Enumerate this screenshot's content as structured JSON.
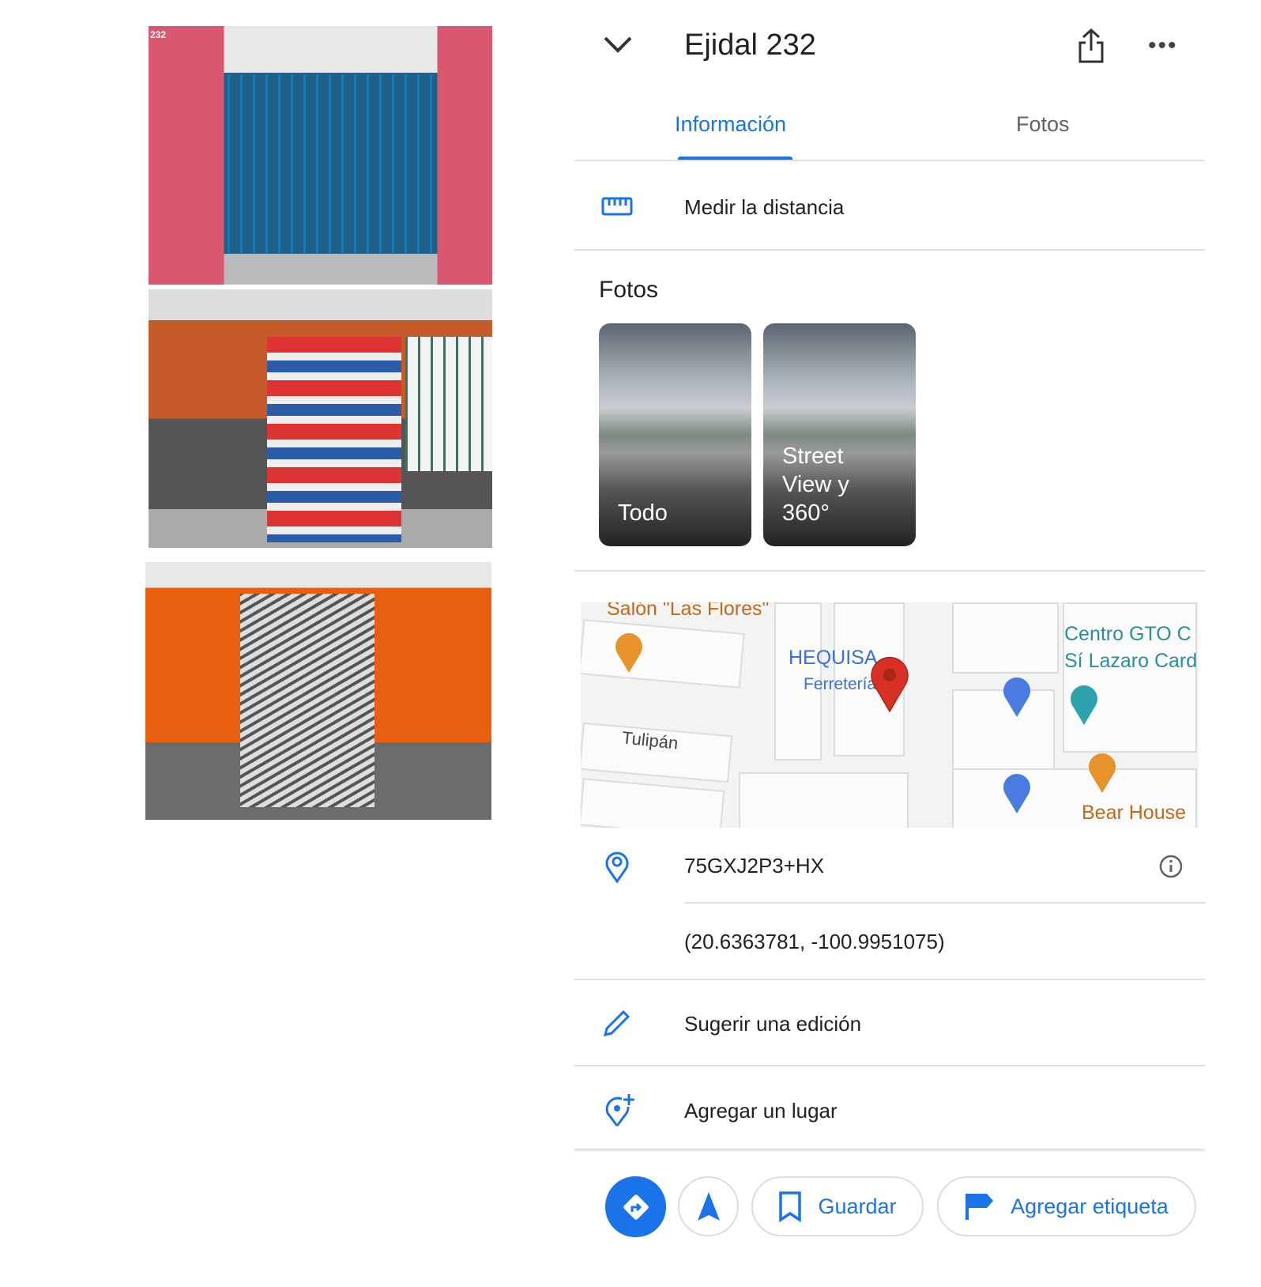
{
  "left_photos": {
    "photo1_caption": "232"
  },
  "header": {
    "title": "Ejidal 232"
  },
  "tabs": [
    {
      "label": "Información",
      "active": true
    },
    {
      "label": "Fotos",
      "active": false
    }
  ],
  "measure": {
    "label": "Medir la distancia"
  },
  "photos": {
    "title": "Fotos",
    "tiles": [
      {
        "label": "Todo"
      },
      {
        "label": "Street View y 360°"
      }
    ]
  },
  "map": {
    "labels": {
      "salon": "Salón \"Las Flores\"",
      "hequisa": "HEQUISA",
      "ferreteria": "Ferretería",
      "tulipan": "Tulipán",
      "centro1": "Centro GTO C",
      "centro2": "Sí Lazaro Card",
      "bear": "Bear House"
    }
  },
  "location": {
    "plus_code": "75GXJ2P3+HX",
    "coords": "(20.6363781, -100.9951075)"
  },
  "actions": {
    "suggest": "Sugerir una edición",
    "add_place": "Agregar un lugar"
  },
  "bottom": {
    "save": "Guardar",
    "label": "Agregar etiqueta"
  },
  "colors": {
    "accent": "#1a73e8",
    "pin": "#d93025"
  }
}
